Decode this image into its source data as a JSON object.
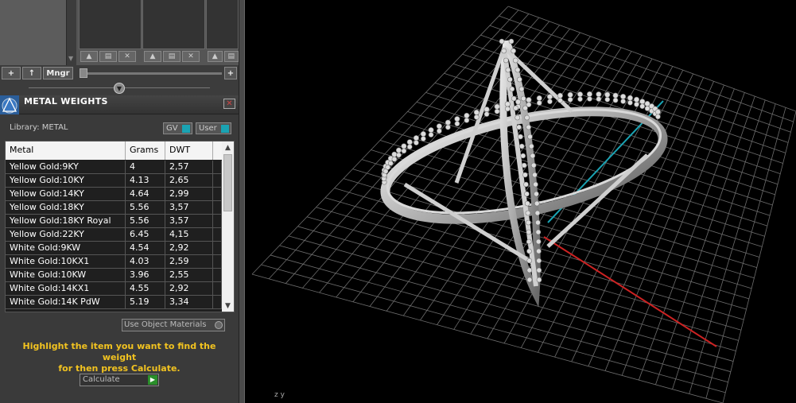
{
  "toolbar": {
    "add_label": "+",
    "up_label": "↑",
    "manager_label": "Mngr",
    "right_add_label": "+"
  },
  "panel": {
    "title": "METAL WEIGHTS",
    "close_label": "✕",
    "library_label": "Library: METAL",
    "gv_label": "GV",
    "user_label": "User"
  },
  "table": {
    "columns": [
      "Metal",
      "Grams",
      "DWT"
    ],
    "rows": [
      {
        "metal": "Yellow Gold:9KY",
        "grams": "4",
        "dwt": "2,57"
      },
      {
        "metal": "Yellow Gold:10KY",
        "grams": "4.13",
        "dwt": "2,65"
      },
      {
        "metal": "Yellow Gold:14KY",
        "grams": "4.64",
        "dwt": "2,99"
      },
      {
        "metal": "Yellow Gold:18KY",
        "grams": "5.56",
        "dwt": "3,57"
      },
      {
        "metal": "Yellow Gold:18KY Royal",
        "grams": "5.56",
        "dwt": "3,57"
      },
      {
        "metal": "Yellow Gold:22KY",
        "grams": "6.45",
        "dwt": "4,15"
      },
      {
        "metal": "White Gold:9KW",
        "grams": "4.54",
        "dwt": "2,92"
      },
      {
        "metal": "White Gold:10KX1",
        "grams": "4.03",
        "dwt": "2,59"
      },
      {
        "metal": "White Gold:10KW",
        "grams": "3.96",
        "dwt": "2,55"
      },
      {
        "metal": "White Gold:14KX1",
        "grams": "4.55",
        "dwt": "2,92"
      },
      {
        "metal": "White Gold:14K PdW",
        "grams": "5.19",
        "dwt": "3,34"
      }
    ]
  },
  "options": {
    "use_object_materials": "Use Object Materials"
  },
  "hint": {
    "line1": "Highlight the item you want to find the weight",
    "line2": "for then press Calculate."
  },
  "actions": {
    "calculate_label": "Calculate"
  },
  "viewport": {
    "axis_label": "z y"
  },
  "colors": {
    "hint": "#f2c320",
    "toggle_accent": "#1aa3b3",
    "axis_x": "#cc2222",
    "axis_y": "#1aa3b3"
  }
}
